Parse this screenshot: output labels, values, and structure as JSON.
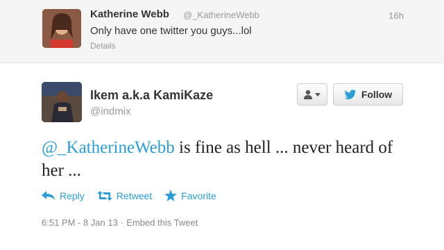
{
  "top_tweet": {
    "name": "Katherine Webb",
    "handle": "@_KatherineWebb",
    "time": "16h",
    "text": "Only have one twitter you guys...lol",
    "details": "Details"
  },
  "main_tweet": {
    "name": "Ikem a.k.a KamiKaze",
    "handle": "@indmix",
    "follow_label": "Follow",
    "mention": "@_KatherineWebb",
    "text_rest": " is fine as hell ... never heard of her ..."
  },
  "actions": {
    "reply": "Reply",
    "retweet": "Retweet",
    "favorite": "Favorite"
  },
  "meta": {
    "timestamp": "6:51 PM - 8 Jan 13",
    "separator": "·",
    "embed": "Embed this Tweet"
  },
  "colors": {
    "link": "#2b9ed8",
    "muted": "#999999",
    "twitter_blue": "#2b9ed8"
  }
}
